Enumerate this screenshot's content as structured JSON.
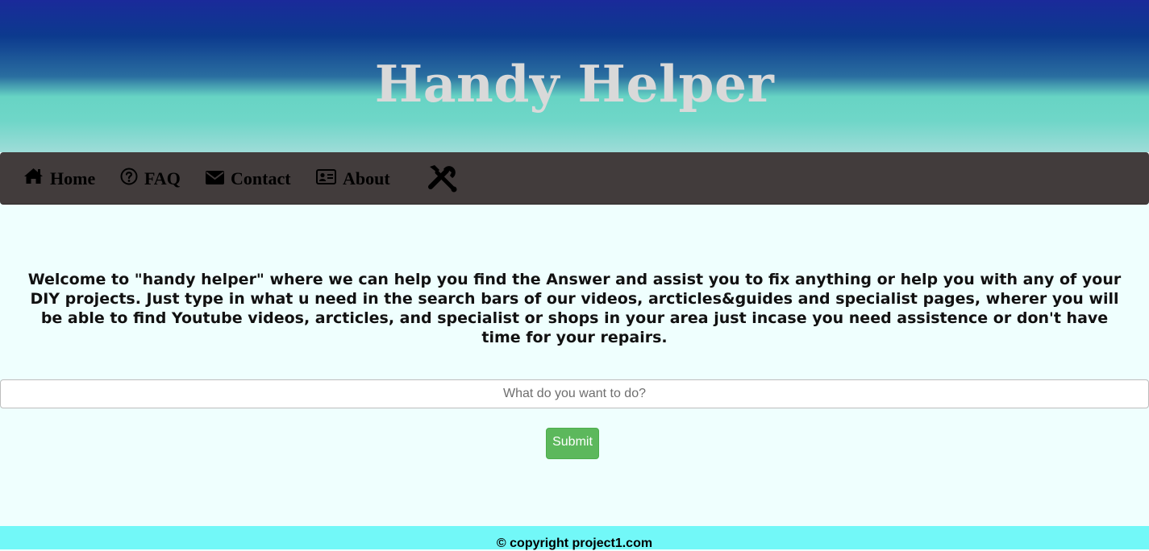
{
  "header": {
    "title": "Handy Helper"
  },
  "nav": {
    "items": [
      {
        "label": "Home",
        "icon": "home-icon"
      },
      {
        "label": "FAQ",
        "icon": "question-circle-icon"
      },
      {
        "label": "Contact",
        "icon": "envelope-icon"
      },
      {
        "label": "About",
        "icon": "id-card-icon"
      }
    ],
    "tools_icon": "tools-icon"
  },
  "main": {
    "welcome_text": "Welcome to \"handy helper\" where we can help you find the Answer and assist you to fix anything or help you with any of your DIY projects. Just type in what u need in the search bars of our videos, arcticles&guides and specialist pages, wherer you will be able to find Youtube videos, arcticles, and specialist or shops in your area just incase you need assistence or don't have time for your repairs.",
    "search": {
      "placeholder": "What do you want to do?",
      "value": ""
    },
    "submit_label": "Submit"
  },
  "footer": {
    "text": "© copyright project1.com"
  },
  "colors": {
    "page_bg": "#effffe",
    "navbar_bg": "#423c3c",
    "submit_bg": "#5cb85c",
    "footer_bg": "#72f8f8",
    "title_color": "#d9d9d9"
  }
}
